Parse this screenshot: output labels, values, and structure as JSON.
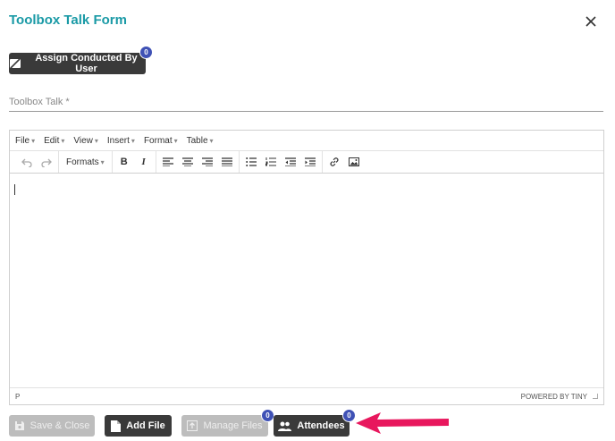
{
  "dialog": {
    "title": "Toolbox Talk Form"
  },
  "assign": {
    "label": "Assign Conducted By User",
    "count": "0"
  },
  "field": {
    "label": "Toolbox Talk *"
  },
  "editor": {
    "menus": [
      "File",
      "Edit",
      "View",
      "Insert",
      "Format",
      "Table"
    ],
    "formats_label": "Formats",
    "status_path": "P",
    "powered_by": "POWERED BY TINY"
  },
  "footer": {
    "save_close": "Save & Close",
    "add_file": "Add File",
    "manage_files": "Manage Files",
    "manage_files_count": "0",
    "attendees": "Attendees",
    "attendees_count": "0"
  },
  "colors": {
    "title": "#1a9aa6",
    "badge": "#3f51b5",
    "arrow": "#e8175d",
    "dark_button": "#3a3a3a"
  }
}
